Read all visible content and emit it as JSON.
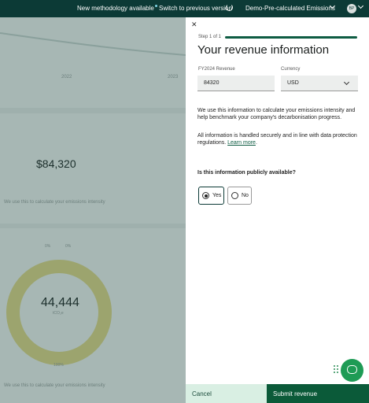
{
  "topbar": {
    "new_methodology": "New methodology available",
    "switch_version": "Switch to previous version",
    "org_name": "Demo-Pre-calculated Emissions",
    "avatar_initials": "BP"
  },
  "background": {
    "year_left": "2022",
    "year_right": "2023",
    "revenue_value": "$84,320",
    "note_1": "We use this to calculate your emissions intensity",
    "donut_value": "44,444",
    "donut_unit": "tCO₂e",
    "donut_label_top_left": "0%",
    "donut_label_top_right": "0%",
    "donut_label_bottom": "100%",
    "note_2": "We use this to calculate your emissions intensity"
  },
  "drawer": {
    "close_icon": "close-icon",
    "step": "Step 1 of 1",
    "progress": 1.0,
    "title": "Your revenue information",
    "revenue_label": "FY2024 Revenue",
    "revenue_value": "84320",
    "currency_label": "Currency",
    "currency_value": "USD",
    "para1": "We use this information to calculate your emissions intensity and help benchmark your company's decarbonisation progress.",
    "para2_text": "All information is handled securely and in line with data protection regulations. ",
    "para2_link": "Learn more",
    "para2_end": ".",
    "question": "Is this information publicly available?",
    "option_yes": "Yes",
    "option_no": "No",
    "selected": "Yes",
    "cancel": "Cancel",
    "submit": "Submit revenue"
  },
  "colors": {
    "topbar": "#0c3a36",
    "accent": "#0b5a39",
    "cancel_bg": "#d9efe3",
    "chat": "#1e9b55"
  }
}
